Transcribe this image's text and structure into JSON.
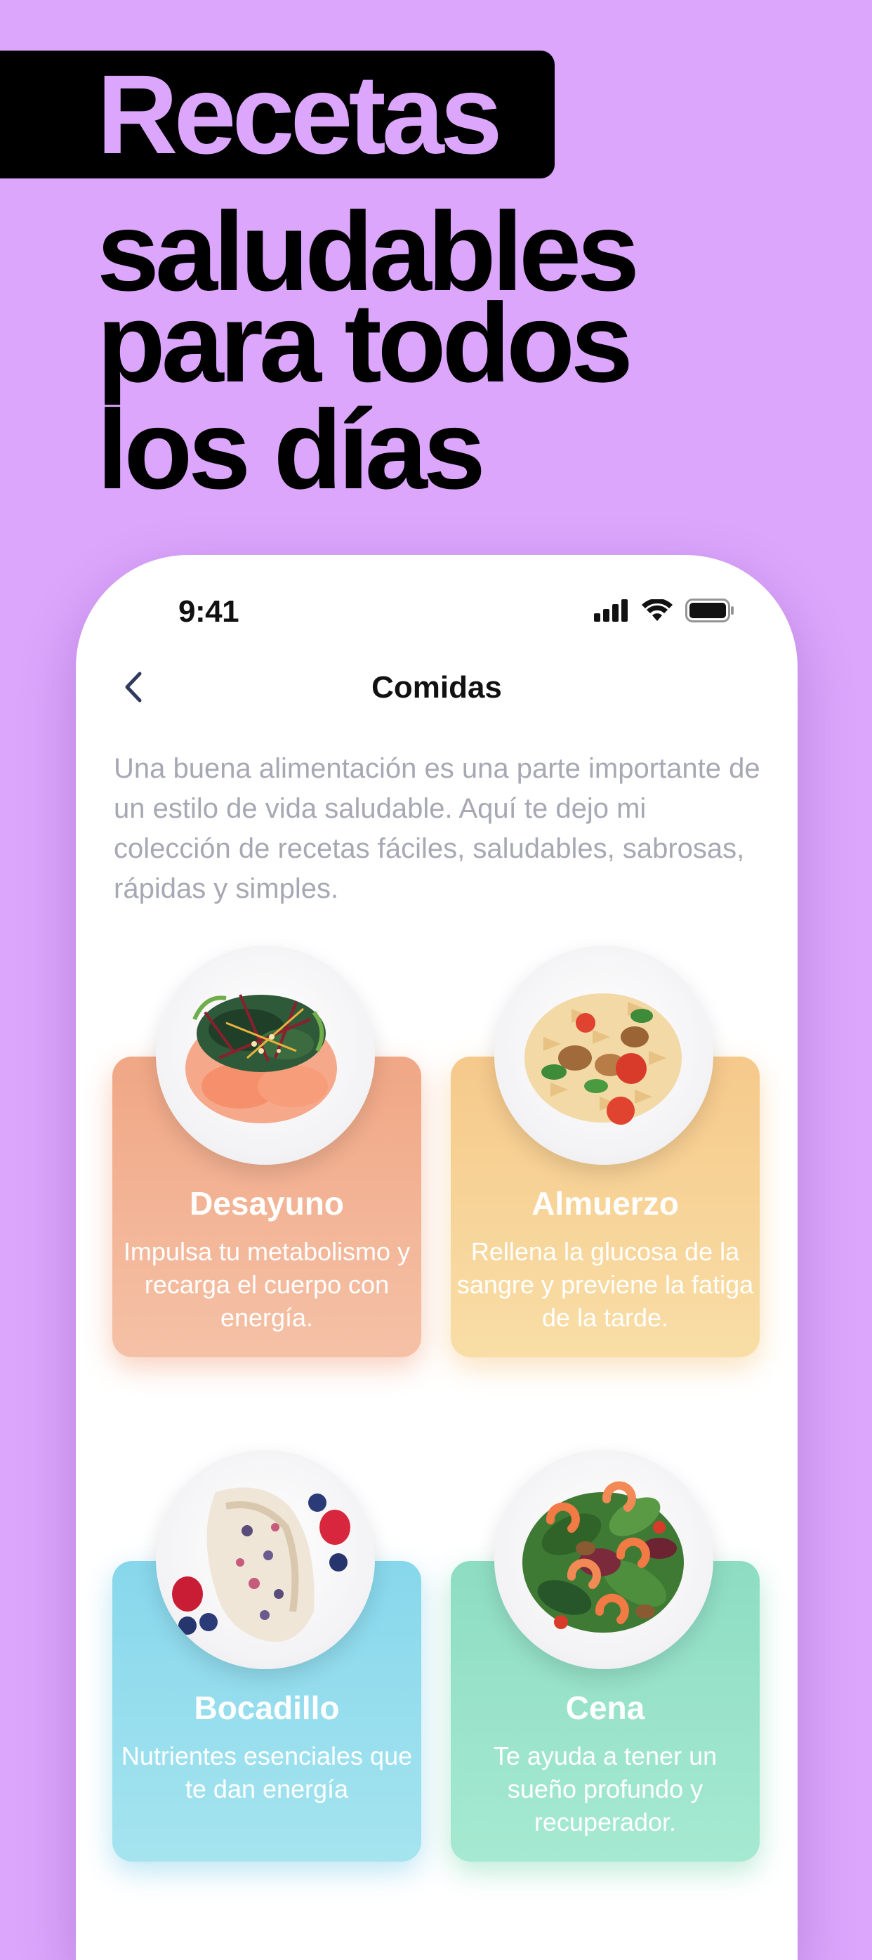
{
  "headline": {
    "highlight": "Recetas",
    "line1": "saludables",
    "line2": "para todos",
    "line3": "los días"
  },
  "status_bar": {
    "time": "9:41",
    "icons": [
      "cellular-signal-icon",
      "wifi-icon",
      "battery-icon"
    ]
  },
  "nav": {
    "back_icon": "chevron-left-icon",
    "title": "Comidas"
  },
  "intro": "Una buena alimentación es una parte importante de un estilo de vida saludable. Aquí te dejo mi colección de recetas fáciles, saludables, sabrosas, rápidas y simples.",
  "meals": [
    {
      "title": "Desayuno",
      "description": "Impulsa tu metabolismo y recarga el cuerpo con energía.",
      "color": "#f0a785",
      "image": "salmon-poke-plate"
    },
    {
      "title": "Almuerzo",
      "description": "Rellena la glucosa de la sangre y previene la fatiga de la tarde.",
      "color": "#f6c98b",
      "image": "farfalle-pasta-plate"
    },
    {
      "title": "Bocadillo",
      "description": "Nutrientes esenciales que te dan energía",
      "color": "#87d7ec",
      "image": "berry-roll-plate"
    },
    {
      "title": "Cena",
      "description": "Te ayuda a tener un sueño profundo y recuperador.",
      "color": "#8dddc2",
      "image": "shrimp-salad-plate"
    }
  ],
  "colors": {
    "background": "#dba6fb",
    "headline_box": "#000000",
    "headline_highlight": "#dba6fb",
    "intro_text": "#a6a8b3"
  }
}
